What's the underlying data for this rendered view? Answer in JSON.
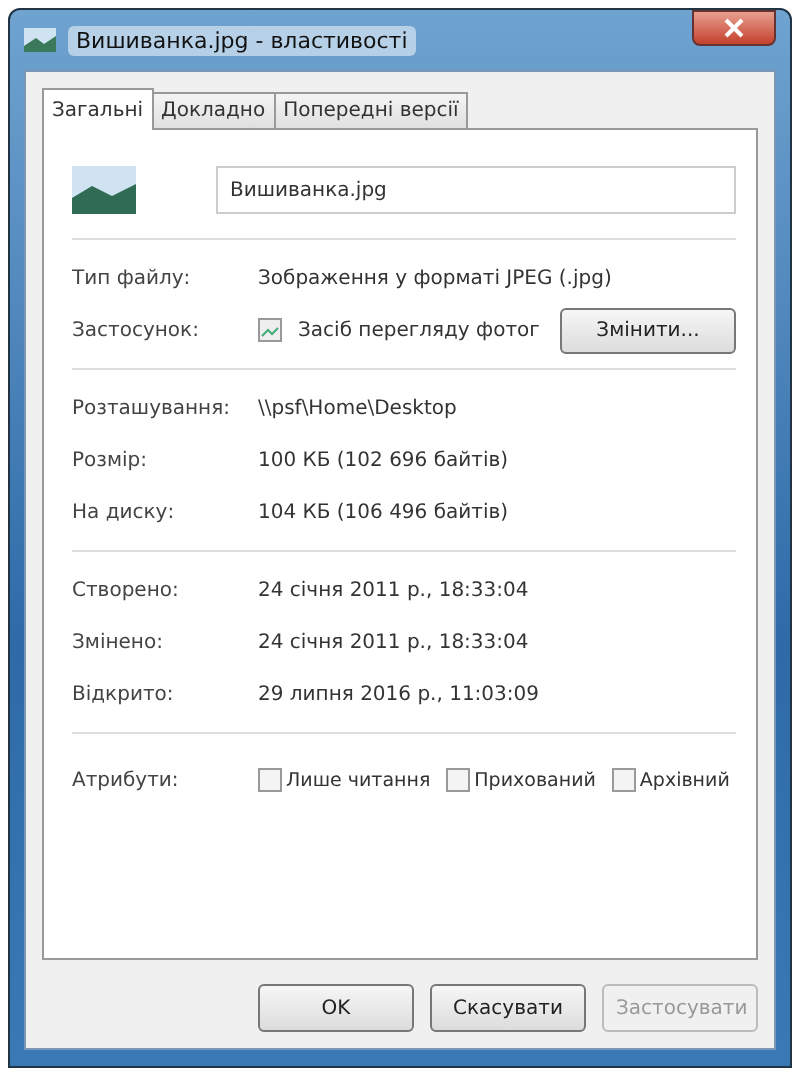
{
  "window": {
    "title": "Вишиванка.jpg - властивості"
  },
  "tabs": [
    {
      "label": "Загальні",
      "selected": true
    },
    {
      "label": "Докладно",
      "selected": false
    },
    {
      "label": "Попередні версії",
      "selected": false
    }
  ],
  "file_name": {
    "value": "Вишиванка.jpg"
  },
  "details": [
    {
      "kind": "text",
      "label": "Тип файлу:",
      "value": "Зображення у форматі JPEG (.jpg)"
    },
    {
      "kind": "app",
      "label": "Застосунок:",
      "value": "Засіб перегляду фотог",
      "button": "Змінити..."
    },
    {
      "kind": "separator"
    },
    {
      "kind": "text",
      "label": "Розташування:",
      "value": "\\\\psf\\Home\\Desktop"
    },
    {
      "kind": "text",
      "label": "Розмір:",
      "value": "100 КБ (102 696 байтів)"
    },
    {
      "kind": "text",
      "label": "На диску:",
      "value": "104 КБ (106 496 байтів)"
    },
    {
      "kind": "separator"
    },
    {
      "kind": "text",
      "label": "Створено:",
      "value": "24 січня 2011 р., 18:33:04"
    },
    {
      "kind": "text",
      "label": "Змінено:",
      "value": "24 січня 2011 р., 18:33:04"
    },
    {
      "kind": "text",
      "label": "Відкрито:",
      "value": "29 липня 2016 р., 11:03:09"
    },
    {
      "kind": "separator"
    }
  ],
  "attributes": {
    "label": "Атрибути:",
    "items": [
      {
        "label": "Лише читання",
        "checked": false
      },
      {
        "label": "Прихований",
        "checked": false
      },
      {
        "label": "Архівний",
        "checked": false
      }
    ]
  },
  "buttons": [
    {
      "label": "OK",
      "disabled": false
    },
    {
      "label": "Скасувати",
      "disabled": false
    },
    {
      "label": "Застосувати",
      "disabled": true
    }
  ]
}
